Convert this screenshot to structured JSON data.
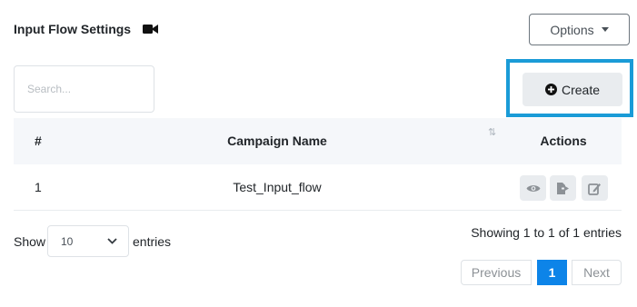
{
  "page": {
    "title": "Input Flow Settings",
    "title_icon": "video-camera-icon"
  },
  "toolbar": {
    "options_label": "Options",
    "create_label": "Create",
    "create_icon": "plus-circle-icon"
  },
  "search": {
    "placeholder": "Search..."
  },
  "table": {
    "columns": [
      "#",
      "Campaign Name",
      "Actions"
    ],
    "rows": [
      {
        "index": "1",
        "campaign_name": "Test_Input_flow",
        "actions": [
          "view-icon",
          "export-icon",
          "edit-icon"
        ]
      }
    ]
  },
  "length": {
    "show_label": "Show",
    "value": "10",
    "entries_label": "entries"
  },
  "info": "Showing 1 to 1 of 1 entries",
  "pagination": {
    "previous": "Previous",
    "current": "1",
    "next": "Next"
  },
  "colors": {
    "highlight": "#1a9bd7",
    "active_page": "#0d84e8",
    "header_bg": "#f5f7fa"
  }
}
